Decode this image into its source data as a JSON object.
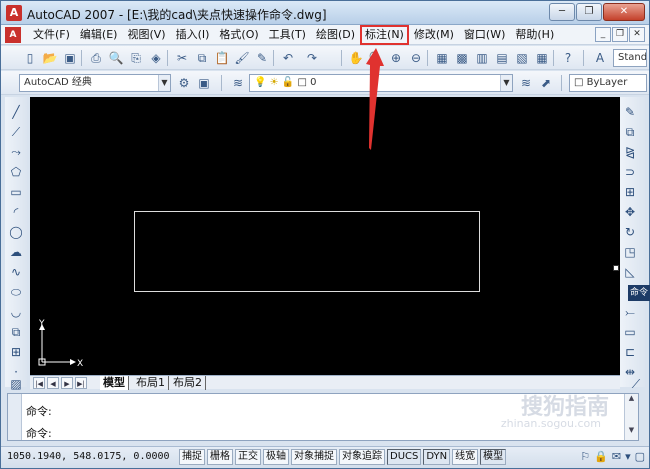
{
  "window": {
    "title": "AutoCAD 2007 - [E:\\我的cad\\夹点快速操作命令.dwg]",
    "app_icon": "autocad-logo-icon"
  },
  "menubar": {
    "items": [
      "文件(F)",
      "编辑(E)",
      "视图(V)",
      "插入(I)",
      "格式(O)",
      "工具(T)",
      "绘图(D)",
      "标注(N)",
      "修改(M)",
      "窗口(W)",
      "帮助(H)"
    ],
    "highlighted": "标注(N)",
    "highlight_color": "#e0322f"
  },
  "toolbar2": {
    "workspace": "AutoCAD 经典",
    "layer": "0",
    "linetype": "ByLayer",
    "textstyle": "Stand"
  },
  "layout_tabs": [
    "模型",
    "布局1",
    "布局2"
  ],
  "active_tab": "模型",
  "canvas": {
    "background": "#000000",
    "ucs_x": "X",
    "ucs_y": "Y"
  },
  "command": {
    "line1": "命令:",
    "line2": "命令:",
    "side_tag": "命令"
  },
  "statusbar": {
    "coords": "1050.1940, 548.0175, 0.0000",
    "buttons": [
      "捕捉",
      "栅格",
      "正交",
      "极轴",
      "对象捕捉",
      "对象追踪",
      "DUCS",
      "DYN",
      "线宽",
      "模型"
    ]
  },
  "watermark": {
    "text": "搜狗指南",
    "url": "zhinan.sogou.com"
  },
  "annotation_color": "#e0322f"
}
